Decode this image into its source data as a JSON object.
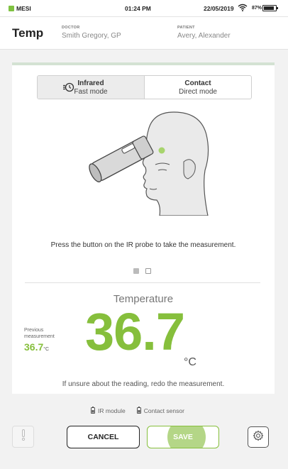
{
  "status_bar": {
    "brand": "MESI",
    "time": "01:24 PM",
    "date": "22/05/2019",
    "battery": "87%",
    "battery_level": 0.87
  },
  "header": {
    "title": "Temp",
    "doctor_label": "DOCTOR",
    "doctor_name": "Smith Gregory, GP",
    "patient_label": "PATIENT",
    "patient_name": "Avery, Alexander"
  },
  "mode": {
    "options": [
      {
        "title": "Infrared",
        "subtitle": "Fast mode",
        "icon": "history-icon",
        "selected": true
      },
      {
        "title": "Contact",
        "subtitle": "Direct mode",
        "selected": false
      }
    ]
  },
  "illustration": {
    "description_icon": "head-with-ir-probe-icon"
  },
  "instruction": "Press the button on the IR probe to take the measurement.",
  "pager": {
    "total": 2,
    "active": 0
  },
  "measurement": {
    "label": "Temperature",
    "value": "36.7",
    "unit": "°C",
    "previous_label": "Previous measurement",
    "previous_value": "36.7",
    "previous_unit": "°C",
    "hint": "If unsure about the reading, redo the measurement."
  },
  "sensors": [
    {
      "label": "IR module",
      "icon": "battery-icon"
    },
    {
      "label": "Contact sensor",
      "icon": "battery-icon"
    }
  ],
  "actions": {
    "cancel_label": "CANCEL",
    "save_label": "SAVE"
  },
  "colors": {
    "accent": "#86bf3c",
    "card_top": "#d4e2d3"
  }
}
